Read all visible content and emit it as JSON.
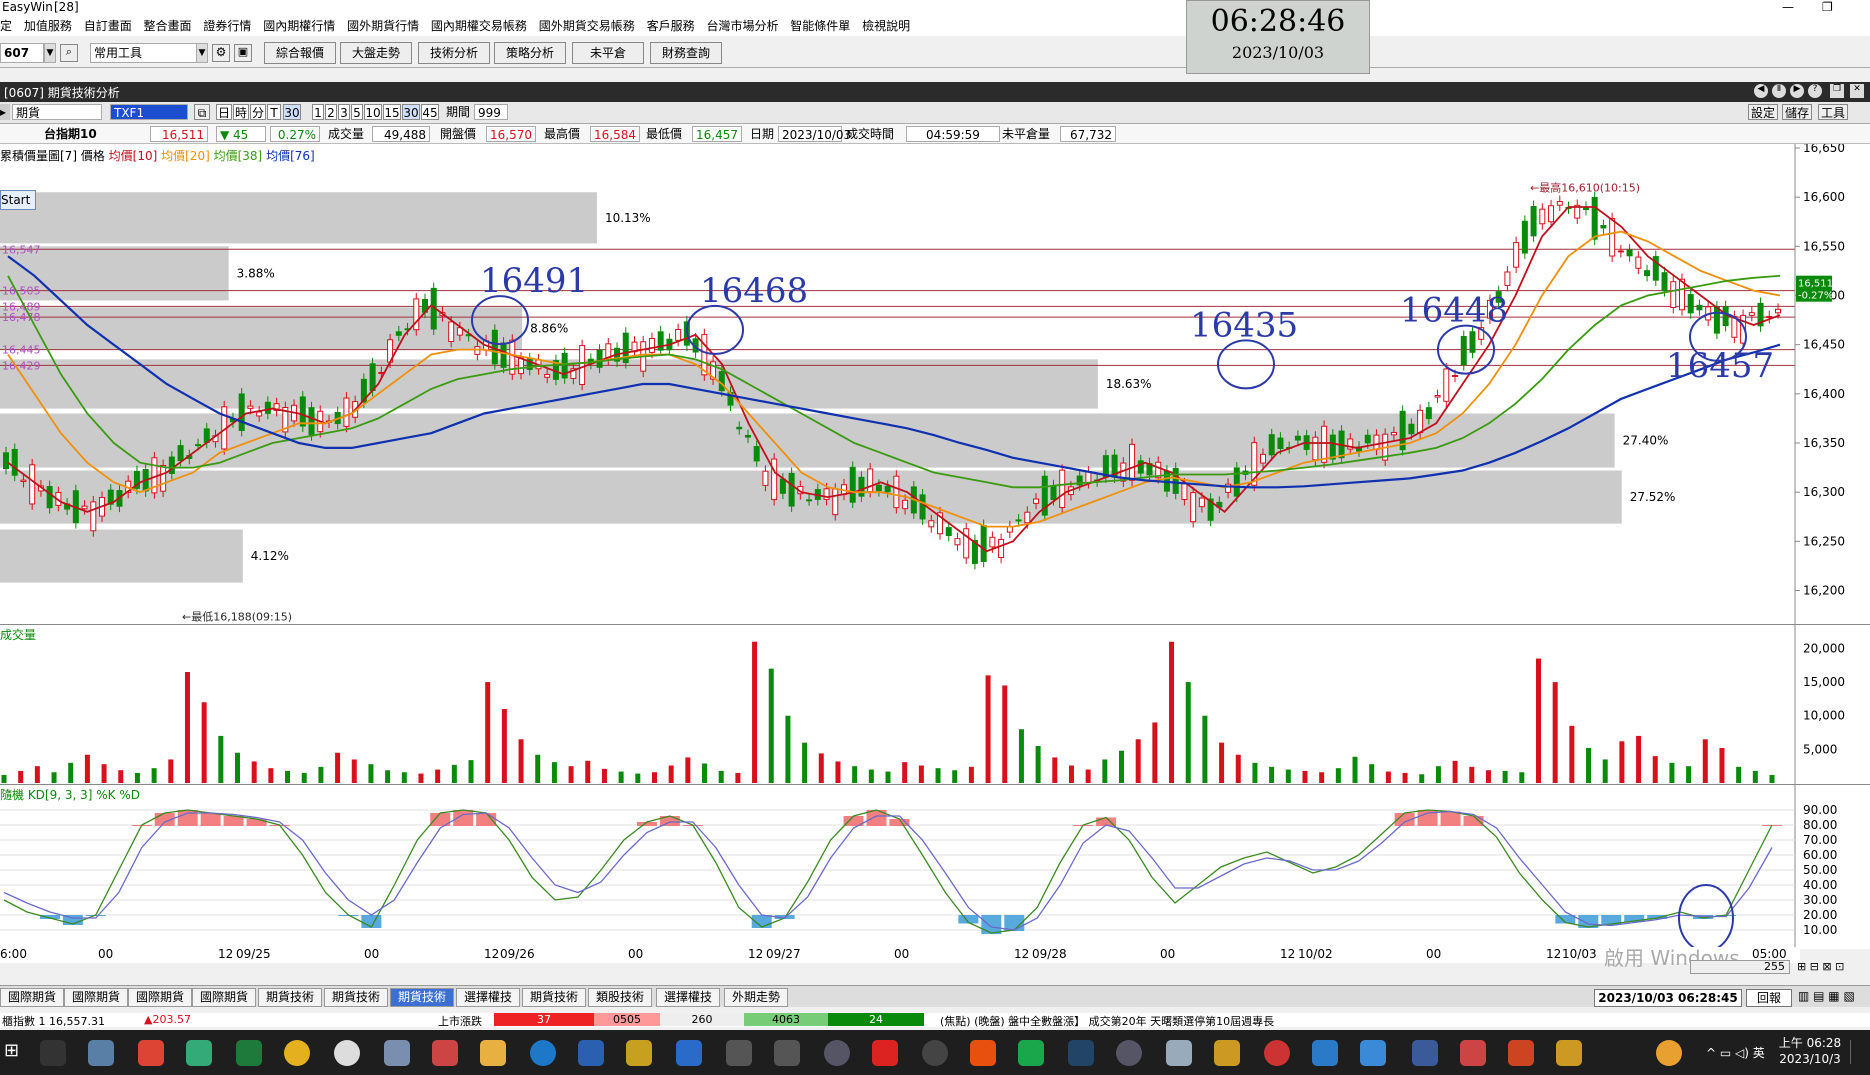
{
  "app": {
    "title": "EasyWin",
    "title_badge": "[28]"
  },
  "menu": [
    "定",
    "加值服務",
    "自訂畫面",
    "整合畫面",
    "證券行情",
    "國內期權行情",
    "國外期貨行情",
    "國內期權交易帳務",
    "國外期貨交易帳務",
    "客戶服務",
    "台灣市場分析",
    "智能條件單",
    "檢視說明"
  ],
  "toolbar": {
    "code": "607",
    "combo": "常用工具",
    "buttons": [
      "綜合報價",
      "大盤走勢",
      "技術分析",
      "策略分析",
      "未平倉",
      "財務查詢"
    ]
  },
  "clock": {
    "time": "06:28:46",
    "date": "2023/10/03"
  },
  "window": {
    "title": "[0607] 期貨技術分析",
    "right_buttons": [
      "設定",
      "儲存",
      "工具"
    ]
  },
  "controls": {
    "product_type": "期貨",
    "contract": "TXF1",
    "periods": [
      "日",
      "時",
      "分",
      "T",
      "30"
    ],
    "minute_options": [
      "1",
      "2",
      "3",
      "5",
      "10",
      "15",
      "30",
      "45"
    ],
    "period_label": "期間",
    "period_value": "999"
  },
  "quote": {
    "name": "台指期10",
    "last": "16,511",
    "change": "▼ 45",
    "change_pct": "0.27%",
    "volume_label": "成交量",
    "volume": "49,488",
    "open_label": "開盤價",
    "open": "16,570",
    "high_label": "最高價",
    "high": "16,584",
    "low_label": "最低價",
    "low": "16,457",
    "date_label": "日期",
    "date": "2023/10/03",
    "time_label": "成交時間",
    "time": "04:59:59",
    "oi_label": "未平倉量",
    "oi": "67,732"
  },
  "legend": {
    "prefix": "累積價量圖[7] 價格",
    "ma10": "均價[10]",
    "ma20": "均價[20]",
    "ma38": "均價[38]",
    "ma76": "均價[76]",
    "start_button": "Start"
  },
  "volume_profile": [
    {
      "label": "10.13%",
      "hi": 16605,
      "lo": 16553,
      "pct": 10.13
    },
    {
      "label": "3.88%",
      "hi": 16550,
      "lo": 16495,
      "pct": 3.88
    },
    {
      "label": "8.86%",
      "hi": 16488,
      "lo": 16445,
      "pct": 8.86
    },
    {
      "label": "18.63%",
      "hi": 16435,
      "lo": 16385,
      "pct": 18.63
    },
    {
      "label": "27.40%",
      "hi": 16380,
      "lo": 16325,
      "pct": 27.4
    },
    {
      "label": "27.52%",
      "hi": 16322,
      "lo": 16268,
      "pct": 27.52
    },
    {
      "label": "4.12%",
      "hi": 16262,
      "lo": 16208,
      "pct": 4.12
    }
  ],
  "left_price_tags": [
    "16,547",
    "16,505",
    "16,489",
    "16,478",
    "16,445",
    "16,429"
  ],
  "price_labels": {
    "last": "16,511",
    "pct": "-0.27%"
  },
  "annotations": {
    "high_note": "最高16,610(10:15)",
    "low_note": "最低16,188(09:15)",
    "big_numbers": [
      "16491",
      "16468",
      "16435",
      "16448",
      "16457"
    ]
  },
  "volume_title": "成交量",
  "kd_title": "隨機 KD[9, 3, 3] %K %D",
  "x_labels": [
    "6:00",
    "00",
    "12",
    "09/25",
    "00",
    "12",
    "09/26",
    "00",
    "12",
    "09/27",
    "00",
    "12",
    "09/28",
    "00",
    "12",
    "10/02",
    "00",
    "12",
    "10/03",
    "05:00"
  ],
  "watermark": "啟用 Windows",
  "zoom_value": "255",
  "tabs": [
    "國際期貨",
    "國際期貨",
    "國際期貨",
    "國際期貨",
    "期貨技術",
    "期貨技術",
    "期貨技術",
    "選擇權技",
    "期貨技術",
    "類股技術",
    "選擇權技",
    "外期走勢"
  ],
  "status_time": "2023/10/03 06:28:45",
  "status_btn": "回報",
  "ticker": {
    "text1": "櫃指數 1 16,557.31",
    "text2": "▲203.57",
    "text3": "上市漲跌",
    "v1": "37",
    "v2": "0505",
    "v3": "260",
    "v4": "4063",
    "v5": "24",
    "news": "(焦點)   (晚盤)   盤中全數盤漲】 成交第20年 天曙類選停第10屆週專長"
  },
  "taskbar": {
    "time": "上午 06:28",
    "date": "2023/10/3"
  },
  "colors": {
    "up": "#d8101c",
    "down": "#0a8a0a",
    "ma10": "#c0101c",
    "ma20": "#f0900a",
    "ma38": "#3a9a10",
    "ma76": "#1030b0",
    "annotation": "#2b3aa8",
    "active_tab": "#3b6fd4"
  },
  "chart_data": [
    {
      "type": "candlestick",
      "title": "累積價量圖[7] 價格",
      "yticks": [
        16200,
        16250,
        16300,
        16350,
        16400,
        16450,
        16500,
        16550,
        16600,
        16650
      ],
      "ylim": [
        16170,
        16650
      ],
      "hlines": [
        16547,
        16505,
        16489,
        16478,
        16445,
        16429
      ],
      "series": [
        {
          "name": "均價[10]",
          "values": [
            16330,
            16310,
            16290,
            16280,
            16290,
            16310,
            16320,
            16340,
            16360,
            16380,
            16385,
            16380,
            16370,
            16380,
            16410,
            16460,
            16490,
            16470,
            16450,
            16440,
            16430,
            16420,
            16430,
            16440,
            16445,
            16450,
            16460,
            16430,
            16370,
            16320,
            16300,
            16295,
            16300,
            16310,
            16300,
            16280,
            16260,
            16240,
            16250,
            16280,
            16300,
            16310,
            16320,
            16330,
            16320,
            16300,
            16280,
            16310,
            16340,
            16350,
            16350,
            16345,
            16350,
            16355,
            16370,
            16410,
            16450,
            16500,
            16560,
            16590,
            16590,
            16570,
            16540,
            16520,
            16500,
            16480,
            16470,
            16480
          ]
        },
        {
          "name": "均價[20]",
          "values": [
            16440,
            16400,
            16360,
            16330,
            16310,
            16300,
            16310,
            16320,
            16340,
            16350,
            16360,
            16370,
            16370,
            16380,
            16400,
            16420,
            16440,
            16445,
            16445,
            16440,
            16435,
            16430,
            16432,
            16436,
            16440,
            16440,
            16430,
            16410,
            16380,
            16350,
            16320,
            16305,
            16300,
            16300,
            16295,
            16285,
            16275,
            16265,
            16265,
            16270,
            16280,
            16290,
            16300,
            16310,
            16315,
            16310,
            16305,
            16310,
            16320,
            16330,
            16335,
            16340,
            16345,
            16350,
            16360,
            16380,
            16410,
            16450,
            16500,
            16540,
            16560,
            16565,
            16555,
            16540,
            16525,
            16515,
            16505,
            16500
          ]
        },
        {
          "name": "均價[38]",
          "values": [
            16520,
            16470,
            16420,
            16380,
            16350,
            16330,
            16325,
            16325,
            16330,
            16340,
            16350,
            16355,
            16360,
            16365,
            16375,
            16390,
            16405,
            16415,
            16420,
            16425,
            16428,
            16430,
            16432,
            16435,
            16438,
            16440,
            16435,
            16425,
            16410,
            16395,
            16380,
            16365,
            16350,
            16340,
            16330,
            16320,
            16315,
            16310,
            16305,
            16305,
            16308,
            16310,
            16312,
            16315,
            16318,
            16318,
            16318,
            16320,
            16322,
            16325,
            16328,
            16332,
            16336,
            16340,
            16345,
            16355,
            16370,
            16390,
            16415,
            16445,
            16470,
            16490,
            16500,
            16505,
            16510,
            16515,
            16518,
            16520
          ]
        },
        {
          "name": "均價[76]",
          "values": [
            16540,
            16520,
            16495,
            16470,
            16450,
            16430,
            16410,
            16395,
            16380,
            16370,
            16360,
            16350,
            16345,
            16345,
            16350,
            16355,
            16360,
            16370,
            16380,
            16385,
            16390,
            16395,
            16400,
            16405,
            16410,
            16410,
            16405,
            16400,
            16395,
            16390,
            16385,
            16380,
            16375,
            16370,
            16365,
            16358,
            16350,
            16343,
            16335,
            16330,
            16325,
            16320,
            16315,
            16312,
            16310,
            16308,
            16306,
            16305,
            16305,
            16306,
            16308,
            16310,
            16312,
            16314,
            16318,
            16322,
            16330,
            16340,
            16352,
            16365,
            16380,
            16395,
            16405,
            16415,
            16425,
            16435,
            16442,
            16450
          ]
        }
      ],
      "annotations": {
        "high": "最高16,610(10:15)",
        "low": "最低16,188(09:15)"
      }
    },
    {
      "type": "bar",
      "title": "成交量",
      "yticks": [
        5000,
        10000,
        15000,
        20000
      ],
      "ylim": [
        0,
        22000
      ],
      "values": [
        1200,
        1800,
        2500,
        1600,
        3000,
        4200,
        2800,
        1900,
        1500,
        2200,
        3500,
        16500,
        12000,
        7000,
        4500,
        3200,
        2200,
        1800,
        1500,
        2400,
        4500,
        3500,
        2800,
        1900,
        1600,
        1400,
        2000,
        2700,
        3400,
        15000,
        11000,
        6500,
        4200,
        3100,
        2500,
        3300,
        2100,
        1700,
        1400,
        1600,
        2600,
        3800,
        2900,
        1800,
        1500,
        21000,
        17000,
        10000,
        6000,
        4400,
        3200,
        2500,
        2000,
        1700,
        3100,
        2600,
        2200,
        1900,
        2400,
        16000,
        14500,
        8000,
        5500,
        3800,
        2600,
        2000,
        3500,
        4800,
        6500,
        9000,
        21000,
        15000,
        10000,
        6000,
        4200,
        3000,
        2400,
        2000,
        1800,
        1600,
        2200,
        3900,
        2800,
        1700,
        1500,
        1300,
        2500,
        3300,
        2400,
        1900,
        1800,
        1600,
        18500,
        15000,
        8500,
        5200,
        3500,
        6200,
        7000,
        4000,
        3000,
        2500,
        6500,
        5200,
        2400,
        1800,
        1200
      ]
    },
    {
      "type": "line",
      "title": "隨機 KD[9, 3, 3] %K %D",
      "yticks": [
        10,
        20,
        30,
        40,
        50,
        60,
        70,
        80,
        90
      ],
      "ylim": [
        0,
        100
      ],
      "series": [
        {
          "name": "%K",
          "values": [
            30,
            22,
            18,
            14,
            20,
            50,
            80,
            88,
            90,
            88,
            86,
            84,
            80,
            60,
            35,
            20,
            12,
            40,
            70,
            88,
            90,
            88,
            70,
            45,
            30,
            32,
            50,
            70,
            82,
            86,
            80,
            55,
            25,
            12,
            18,
            42,
            70,
            86,
            90,
            84,
            60,
            35,
            15,
            8,
            10,
            25,
            55,
            80,
            85,
            70,
            45,
            28,
            40,
            52,
            58,
            62,
            55,
            48,
            52,
            60,
            74,
            88,
            90,
            89,
            86,
            72,
            48,
            30,
            15,
            12,
            14,
            16,
            18,
            22,
            18,
            20,
            50,
            80
          ]
        },
        {
          "name": "%D",
          "values": [
            35,
            28,
            22,
            18,
            18,
            35,
            65,
            82,
            88,
            88,
            87,
            85,
            82,
            70,
            48,
            30,
            20,
            30,
            55,
            78,
            87,
            88,
            78,
            58,
            40,
            35,
            42,
            60,
            75,
            82,
            82,
            65,
            40,
            20,
            18,
            32,
            58,
            78,
            86,
            86,
            70,
            48,
            25,
            12,
            10,
            18,
            40,
            68,
            80,
            76,
            58,
            38,
            38,
            46,
            54,
            58,
            56,
            50,
            50,
            56,
            68,
            82,
            88,
            89,
            87,
            78,
            58,
            40,
            22,
            14,
            13,
            15,
            17,
            20,
            19,
            19,
            38,
            65
          ]
        }
      ]
    }
  ]
}
